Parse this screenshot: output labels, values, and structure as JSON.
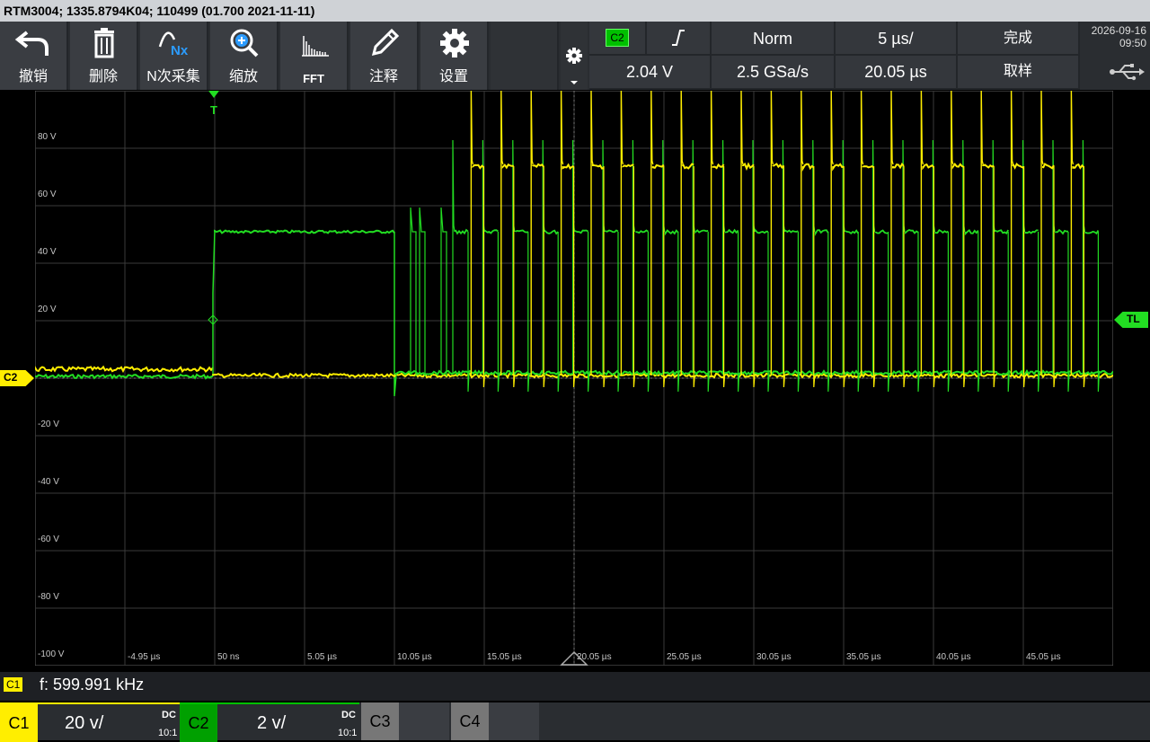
{
  "title": "RTM3004; 1335.8794K04; 110499 (01.700 2021-11-11)",
  "toolbar": {
    "undo": "撤销",
    "delete": "删除",
    "nx": "N次采集",
    "nx_icon_text": "Nx",
    "zoom": "缩放",
    "fft": "FFT",
    "annotate": "注释",
    "settings": "设置"
  },
  "header": {
    "trigger_source": "C2",
    "trigger_level": "2.04 V",
    "trigger_mode": "Norm",
    "sample_rate": "2.5 GSa/s",
    "timebase": "5 µs/",
    "position": "20.05 µs",
    "status_top": "完成",
    "status_bottom": "取样",
    "date": "2026-09-16",
    "time": "09:50"
  },
  "y_labels": [
    "80 V",
    "60 V",
    "40 V",
    "20 V",
    "",
    "-20 V",
    "-40 V",
    "-60 V",
    "-80 V",
    "-100 V"
  ],
  "x_labels": [
    "-4.95 µs",
    "50 ns",
    "5.05 µs",
    "10.05 µs",
    "15.05 µs",
    "20.05 µs",
    "25.05 µs",
    "30.05 µs",
    "35.05 µs",
    "40.05 µs",
    "45.05 µs"
  ],
  "markers": {
    "trigger": "T",
    "trigger_level": "TL",
    "channel": "C2"
  },
  "status": {
    "channel": "C1",
    "freq": "f: 599.991 kHz"
  },
  "channels": [
    {
      "name": "C1",
      "scale": "20 v/",
      "coupling": "DC",
      "probe": "10:1",
      "color": "#ffee00"
    },
    {
      "name": "C2",
      "scale": "2 v/",
      "coupling": "DC",
      "probe": "10:1",
      "color": "#00c000"
    },
    {
      "name": "C3"
    },
    {
      "name": "C4"
    }
  ],
  "colors": {
    "ch1": "#ffee00",
    "ch2": "#22dd22"
  }
}
